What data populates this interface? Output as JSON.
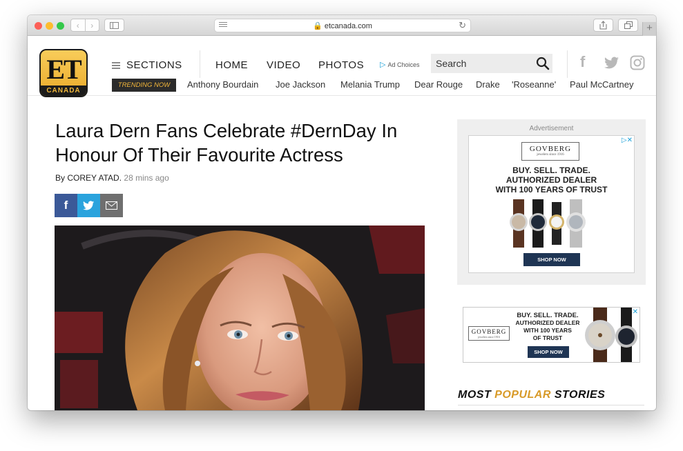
{
  "browser": {
    "url": "etcanada.com",
    "lights": [
      "#fc5f57",
      "#fdbc2e",
      "#34c84a"
    ]
  },
  "header": {
    "logo_top": "ET",
    "logo_bottom": "CANADA",
    "sections_label": "SECTIONS",
    "nav": [
      "HOME",
      "VIDEO",
      "PHOTOS"
    ],
    "ad_choices": "Ad Choices",
    "search_placeholder": "Search",
    "trending_label": "TRENDING NOW",
    "trending": [
      "Anthony Bourdain",
      "Joe Jackson",
      "Melania Trump",
      "Dear Rouge",
      "Drake",
      "'Roseanne'",
      "Paul McCartney"
    ],
    "social_icons": [
      "facebook-icon",
      "twitter-icon",
      "instagram-icon"
    ]
  },
  "article": {
    "headline": "Laura Dern Fans Celebrate #DernDay In Honour Of Their Favourite Actress",
    "byline_prefix": "By",
    "author": "COREY ATAD.",
    "time": "28 mins ago",
    "share_colors": {
      "facebook": "#3b5998",
      "twitter": "#2aa3dd",
      "email": "#6f6f6f"
    }
  },
  "sidebar": {
    "ad_label": "Advertisement",
    "ad1": {
      "brand": "GOVBERG",
      "brand_sub": "jewelers since 1916",
      "line1": "BUY. SELL. TRADE.",
      "line2": "AUTHORIZED DEALER",
      "line3": "WITH 100 YEARS OF TRUST",
      "cta": "SHOP NOW"
    },
    "ad2": {
      "brand": "GOVBERG",
      "brand_sub": "jewelers since 1916",
      "line1": "BUY. SELL. TRADE.",
      "line2": "AUTHORIZED DEALER",
      "line3": "WITH 100 YEARS",
      "line4": "OF TRUST",
      "cta": "SHOP NOW"
    },
    "popular_prefix": "MOST",
    "popular_accent": "POPULAR",
    "popular_suffix": "STORIES"
  }
}
